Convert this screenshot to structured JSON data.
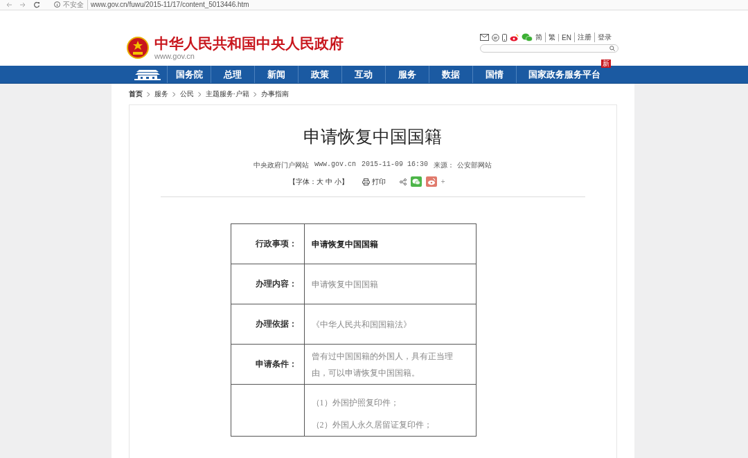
{
  "browser": {
    "security": "不安全",
    "url": "www.gov.cn/fuwu/2015-11/17/content_5013446.htm"
  },
  "header": {
    "site_title": "中华人民共和国中央人民政府",
    "site_domain": "www.gov.cn",
    "links": [
      "简",
      "繁",
      "EN",
      "注册",
      "登录"
    ]
  },
  "nav": {
    "items": [
      "国务院",
      "总理",
      "新闻",
      "政策",
      "互动",
      "服务",
      "数据",
      "国情",
      "国家政务服务平台"
    ],
    "badge": "新"
  },
  "breadcrumb": [
    "首页",
    "服务",
    "公民",
    "主题服务·户籍",
    "办事指南"
  ],
  "article": {
    "title": "申请恢复中国国籍",
    "site": "中央政府门户网站",
    "domain": "www.gov.cn",
    "datetime": "2015-11-09 16:30",
    "source_label": "来源：",
    "source": "公安部网站",
    "font_size": "【字体：大 中 小】",
    "print": "打印",
    "more": "+"
  },
  "table": {
    "rows": [
      {
        "label": "行政事项：",
        "emphasis": true,
        "lines": [
          "申请恢复中国国籍"
        ]
      },
      {
        "label": "办理内容：",
        "emphasis": false,
        "lines": [
          "申请恢复中国国籍"
        ]
      },
      {
        "label": "办理依据：",
        "emphasis": false,
        "lines": [
          "《中华人民共和国国籍法》"
        ]
      },
      {
        "label": "申请条件：",
        "emphasis": false,
        "lines": [
          "曾有过中国国籍的外国人，具有正当理由，可以申请恢复中国国籍。"
        ]
      },
      {
        "emphasis": false,
        "lines": [
          "（1）外国护照复印件；",
          "（2）外国人永久居留证复印件；"
        ]
      }
    ]
  }
}
